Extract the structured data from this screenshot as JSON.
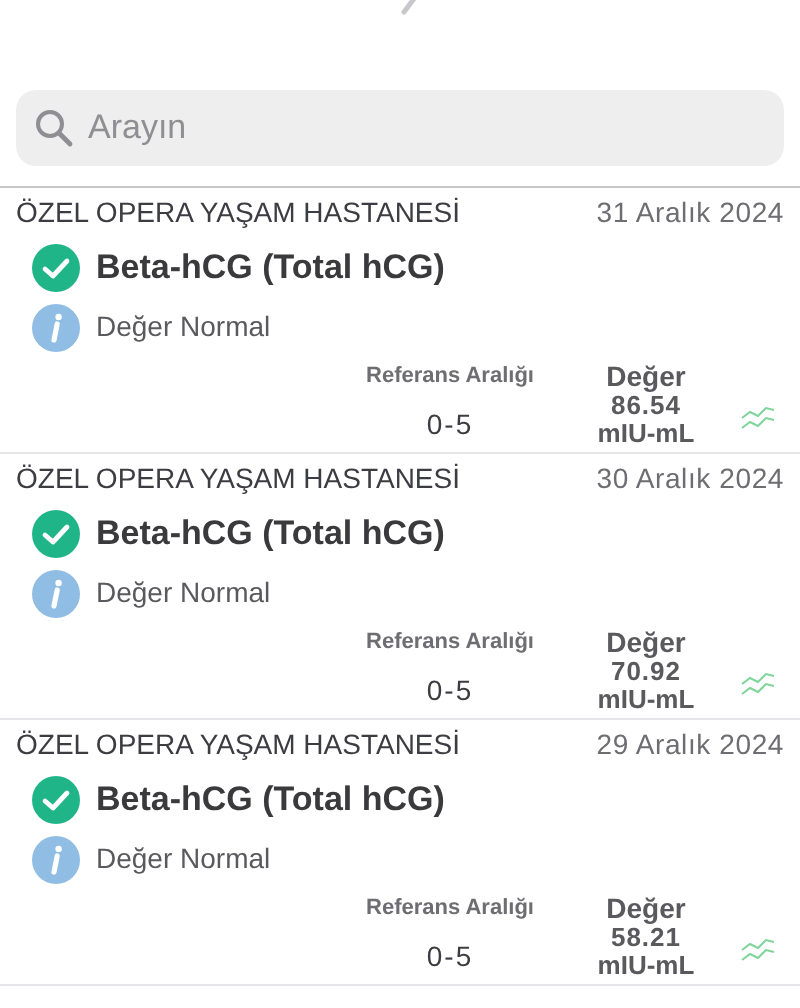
{
  "search": {
    "placeholder": "Arayın"
  },
  "results": [
    {
      "hospital": "ÖZEL OPERA YAŞAM HASTANESİ",
      "date": "31 Aralık 2024",
      "test": "Beta-hCG (Total hCG)",
      "status": "Değer Normal",
      "range_label": "Referans Aralığı",
      "range": "0-5",
      "value_label": "Değer",
      "value": "86.54",
      "unit": "mIU-mL"
    },
    {
      "hospital": "ÖZEL OPERA YAŞAM HASTANESİ",
      "date": "30 Aralık 2024",
      "test": "Beta-hCG (Total hCG)",
      "status": "Değer Normal",
      "range_label": "Referans Aralığı",
      "range": "0-5",
      "value_label": "Değer",
      "value": "70.92",
      "unit": "mIU-mL"
    },
    {
      "hospital": "ÖZEL OPERA YAŞAM HASTANESİ",
      "date": "29 Aralık 2024",
      "test": "Beta-hCG (Total hCG)",
      "status": "Değer Normal",
      "range_label": "Referans Aralığı",
      "range": "0-5",
      "value_label": "Değer",
      "value": "58.21",
      "unit": "mIU-mL"
    }
  ]
}
